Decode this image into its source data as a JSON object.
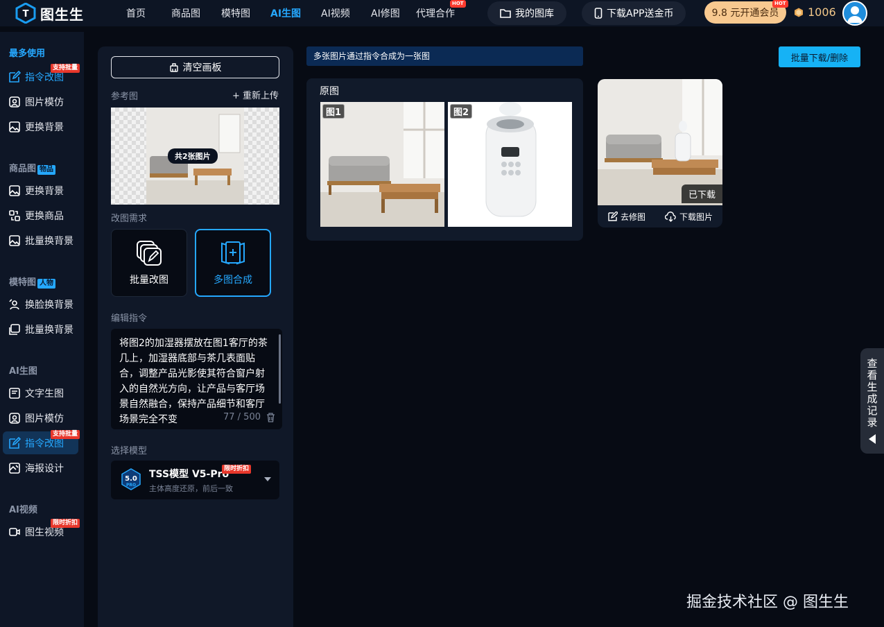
{
  "brand": {
    "name": "图生生"
  },
  "nav": {
    "items": [
      "首页",
      "商品图",
      "模特图",
      "AI生图",
      "AI视频",
      "AI修图",
      "代理合作"
    ],
    "hot_badge": "HOT",
    "gallery": "我的图库",
    "download_app": "下载APP送金币",
    "vip": "9.8 元开通会员",
    "coins": "1006"
  },
  "sidebar": {
    "sections": {
      "frequent": "最多使用",
      "product": "商品图",
      "product_tag": "物品",
      "model": "模特图",
      "model_tag": "人物",
      "ai_gen": "AI生图",
      "ai_video": "AI视频"
    },
    "items": {
      "cmd_edit": "指令改图",
      "img_model": "图片模仿",
      "bg_change": "更换背景",
      "p_bg_change": "更换背景",
      "p_change": "更换商品",
      "p_batch_bg": "批量换背景",
      "m_face": "换脸换背景",
      "m_batch_bg": "批量换背景",
      "txt2img": "文字生图",
      "a_img_model": "图片模仿",
      "a_cmd_edit": "指令改图",
      "poster": "海报设计",
      "img2video": "图生视频"
    },
    "badges": {
      "batch": "支持批量",
      "discount": "限时折扣"
    }
  },
  "panel": {
    "clear": "清空画板",
    "ref_label": "参考图",
    "reupload": "+ 重新上传",
    "ref_count": "共2张图片",
    "req_label": "改图需求",
    "modes": [
      "批量改图",
      "多图合成"
    ],
    "cmd_label": "编辑指令",
    "cmd_text": "将图2的加湿器摆放在图1客厅的茶几上，加湿器底部与茶几表面贴合，调整产品光影使其符合窗户射入的自然光方向，让产品与客厅场景自然融合，保持产品细节和客厅场景完全不变",
    "counter": "77 / 500",
    "model_label": "选择模型",
    "model_name": "TSS模型 V5-Pro",
    "model_badge": "限时折扣",
    "model_desc": "主体高度还原，前后一致",
    "model_icon_text": "5.0",
    "model_icon_sub": "PRO"
  },
  "main": {
    "banner": "多张图片通过指令合成为一张图",
    "batch_btn": "批量下载/删除",
    "orig_title": "原图",
    "tags": [
      "图1",
      "图2"
    ],
    "downloaded": "已下载",
    "edit": "去修图",
    "download": "下载图片"
  },
  "history": "查看生成记录",
  "watermark": "掘金技术社区 @ 图生生"
}
